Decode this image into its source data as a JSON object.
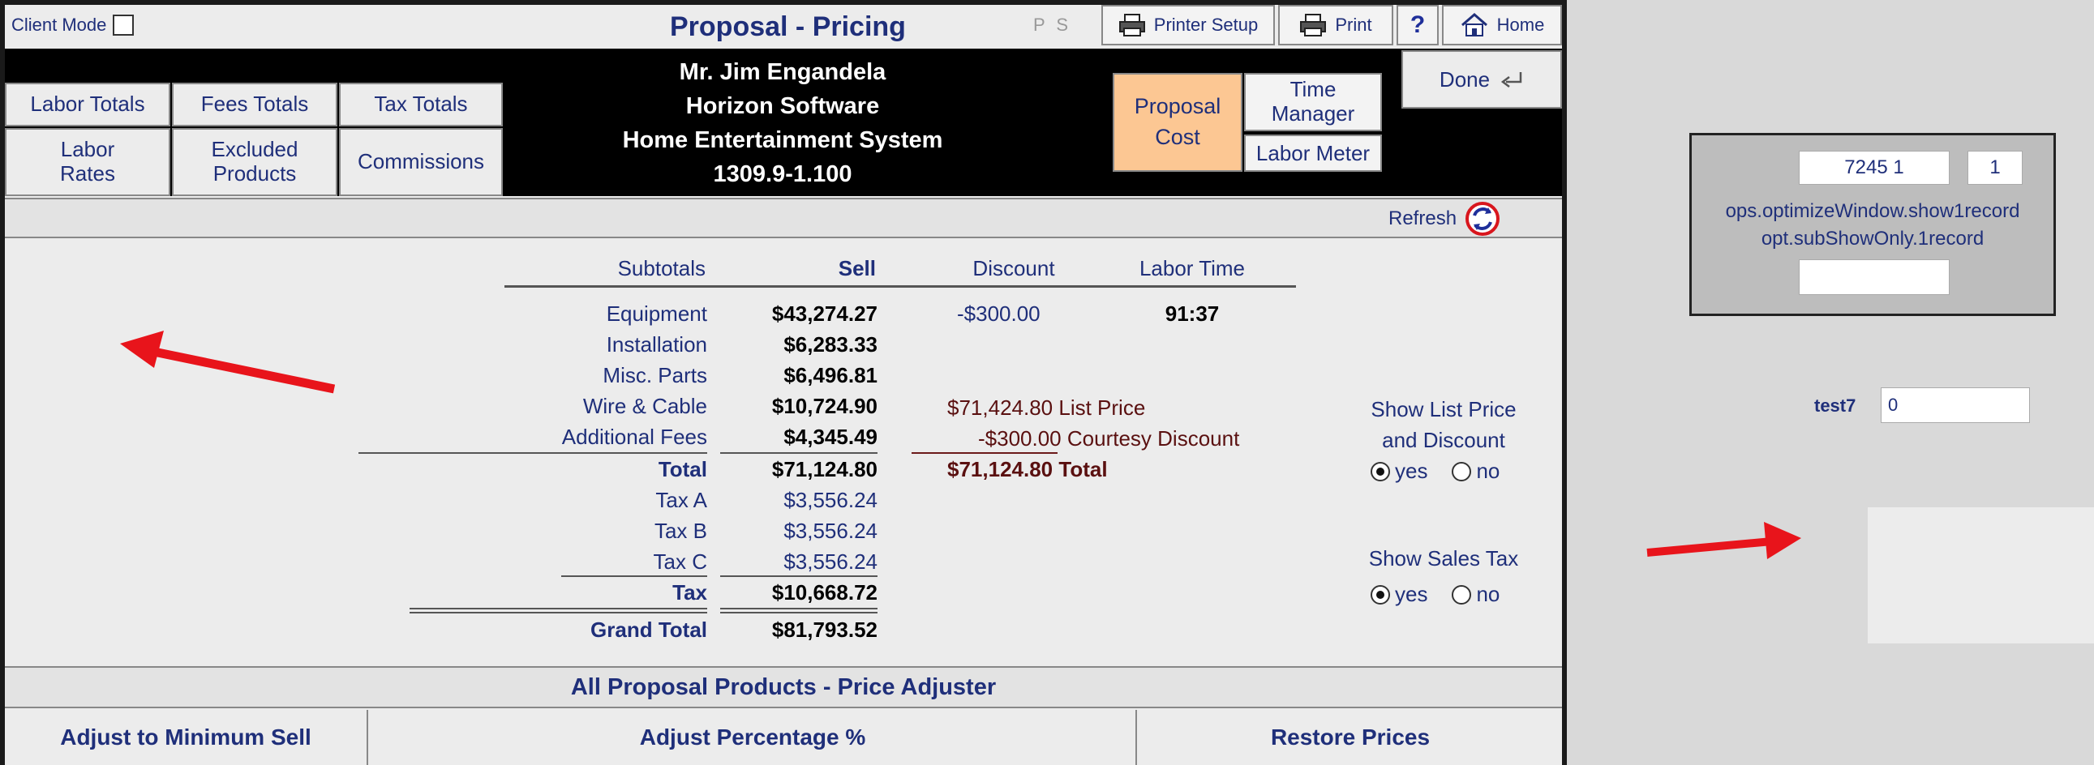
{
  "header": {
    "client_mode_label": "Client Mode",
    "title": "Proposal - Pricing",
    "ps": "P S",
    "printer_setup": "Printer Setup",
    "print": "Print",
    "help": "?",
    "home": "Home",
    "done": "Done"
  },
  "nav": {
    "labor_totals": "Labor Totals",
    "fees_totals": "Fees Totals",
    "tax_totals": "Tax Totals",
    "labor_rates_1": "Labor",
    "labor_rates_2": "Rates",
    "excluded_products_1": "Excluded",
    "excluded_products_2": "Products",
    "commissions": "Commissions",
    "proposal_cost_1": "Proposal",
    "proposal_cost_2": "Cost",
    "time_manager_1": "Time",
    "time_manager_2": "Manager",
    "labor_meter": "Labor Meter"
  },
  "client": {
    "name": "Mr. Jim Engandela",
    "company": "Horizon Software",
    "project": "Home Entertainment System",
    "number": "1309.9-1.100"
  },
  "refresh_label": "Refresh",
  "table": {
    "headers": {
      "subtotals": "Subtotals",
      "sell": "Sell",
      "discount": "Discount",
      "labor_time": "Labor Time"
    },
    "rows": [
      {
        "label": "Equipment",
        "sell": "$43,274.27"
      },
      {
        "label": "Installation",
        "sell": "$6,283.33"
      },
      {
        "label": "Misc. Parts",
        "sell": "$6,496.81"
      },
      {
        "label": "Wire & Cable",
        "sell": "$10,724.90"
      },
      {
        "label": "Additional Fees",
        "sell": "$4,345.49"
      }
    ],
    "equipment_discount": "-$300.00",
    "equipment_labor_time": "91:37",
    "total_label": "Total",
    "total_sell": "$71,124.80",
    "taxes": [
      {
        "label": "Tax A",
        "value": "$3,556.24"
      },
      {
        "label": "Tax B",
        "value": "$3,556.24"
      },
      {
        "label": "Tax C",
        "value": "$3,556.24"
      }
    ],
    "tax_label": "Tax",
    "tax_total": "$10,668.72",
    "grand_total_label": "Grand Total",
    "grand_total": "$81,793.52"
  },
  "summary": {
    "list_price_value": "$71,424.80",
    "list_price_label": "List Price",
    "courtesy_value": "-$300.00",
    "courtesy_label": "Courtesy Discount",
    "total_value": "$71,124.80",
    "total_label": "Total"
  },
  "options": {
    "list_price_line1": "Show List Price",
    "list_price_line2": "and Discount",
    "sales_tax": "Show Sales Tax",
    "yes": "yes",
    "no": "no",
    "list_price_selected": "yes",
    "sales_tax_selected": "yes"
  },
  "adjuster": {
    "title": "All Proposal Products - Price Adjuster",
    "min_sell": "Adjust to Minimum Sell",
    "percentage": "Adjust Percentage %",
    "restore": "Restore Prices"
  },
  "debug": {
    "field1": "7245 1",
    "field2": "1",
    "line1": "ops.optimizeWindow.show1record",
    "line2": "opt.subShowOnly.1record",
    "field3": ""
  },
  "test7": {
    "label": "test7",
    "value": "0"
  },
  "colors": {
    "accent_cost": "#fcc793",
    "text_blue": "#1f2f7a",
    "arrow_red": "#e8141b"
  }
}
